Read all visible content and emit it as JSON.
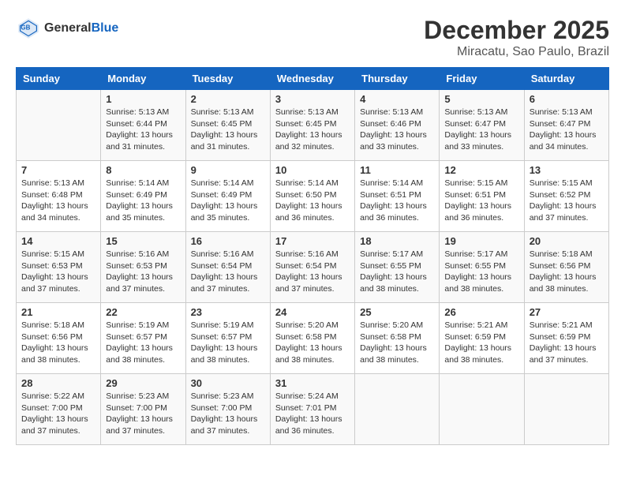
{
  "header": {
    "logo_line1": "General",
    "logo_line2": "Blue",
    "month_year": "December 2025",
    "location": "Miracatu, Sao Paulo, Brazil"
  },
  "days_of_week": [
    "Sunday",
    "Monday",
    "Tuesday",
    "Wednesday",
    "Thursday",
    "Friday",
    "Saturday"
  ],
  "weeks": [
    [
      {
        "day": "",
        "info": ""
      },
      {
        "day": "1",
        "info": "Sunrise: 5:13 AM\nSunset: 6:44 PM\nDaylight: 13 hours\nand 31 minutes."
      },
      {
        "day": "2",
        "info": "Sunrise: 5:13 AM\nSunset: 6:45 PM\nDaylight: 13 hours\nand 31 minutes."
      },
      {
        "day": "3",
        "info": "Sunrise: 5:13 AM\nSunset: 6:45 PM\nDaylight: 13 hours\nand 32 minutes."
      },
      {
        "day": "4",
        "info": "Sunrise: 5:13 AM\nSunset: 6:46 PM\nDaylight: 13 hours\nand 33 minutes."
      },
      {
        "day": "5",
        "info": "Sunrise: 5:13 AM\nSunset: 6:47 PM\nDaylight: 13 hours\nand 33 minutes."
      },
      {
        "day": "6",
        "info": "Sunrise: 5:13 AM\nSunset: 6:47 PM\nDaylight: 13 hours\nand 34 minutes."
      }
    ],
    [
      {
        "day": "7",
        "info": "Sunrise: 5:13 AM\nSunset: 6:48 PM\nDaylight: 13 hours\nand 34 minutes."
      },
      {
        "day": "8",
        "info": "Sunrise: 5:14 AM\nSunset: 6:49 PM\nDaylight: 13 hours\nand 35 minutes."
      },
      {
        "day": "9",
        "info": "Sunrise: 5:14 AM\nSunset: 6:49 PM\nDaylight: 13 hours\nand 35 minutes."
      },
      {
        "day": "10",
        "info": "Sunrise: 5:14 AM\nSunset: 6:50 PM\nDaylight: 13 hours\nand 36 minutes."
      },
      {
        "day": "11",
        "info": "Sunrise: 5:14 AM\nSunset: 6:51 PM\nDaylight: 13 hours\nand 36 minutes."
      },
      {
        "day": "12",
        "info": "Sunrise: 5:15 AM\nSunset: 6:51 PM\nDaylight: 13 hours\nand 36 minutes."
      },
      {
        "day": "13",
        "info": "Sunrise: 5:15 AM\nSunset: 6:52 PM\nDaylight: 13 hours\nand 37 minutes."
      }
    ],
    [
      {
        "day": "14",
        "info": "Sunrise: 5:15 AM\nSunset: 6:53 PM\nDaylight: 13 hours\nand 37 minutes."
      },
      {
        "day": "15",
        "info": "Sunrise: 5:16 AM\nSunset: 6:53 PM\nDaylight: 13 hours\nand 37 minutes."
      },
      {
        "day": "16",
        "info": "Sunrise: 5:16 AM\nSunset: 6:54 PM\nDaylight: 13 hours\nand 37 minutes."
      },
      {
        "day": "17",
        "info": "Sunrise: 5:16 AM\nSunset: 6:54 PM\nDaylight: 13 hours\nand 37 minutes."
      },
      {
        "day": "18",
        "info": "Sunrise: 5:17 AM\nSunset: 6:55 PM\nDaylight: 13 hours\nand 38 minutes."
      },
      {
        "day": "19",
        "info": "Sunrise: 5:17 AM\nSunset: 6:55 PM\nDaylight: 13 hours\nand 38 minutes."
      },
      {
        "day": "20",
        "info": "Sunrise: 5:18 AM\nSunset: 6:56 PM\nDaylight: 13 hours\nand 38 minutes."
      }
    ],
    [
      {
        "day": "21",
        "info": "Sunrise: 5:18 AM\nSunset: 6:56 PM\nDaylight: 13 hours\nand 38 minutes."
      },
      {
        "day": "22",
        "info": "Sunrise: 5:19 AM\nSunset: 6:57 PM\nDaylight: 13 hours\nand 38 minutes."
      },
      {
        "day": "23",
        "info": "Sunrise: 5:19 AM\nSunset: 6:57 PM\nDaylight: 13 hours\nand 38 minutes."
      },
      {
        "day": "24",
        "info": "Sunrise: 5:20 AM\nSunset: 6:58 PM\nDaylight: 13 hours\nand 38 minutes."
      },
      {
        "day": "25",
        "info": "Sunrise: 5:20 AM\nSunset: 6:58 PM\nDaylight: 13 hours\nand 38 minutes."
      },
      {
        "day": "26",
        "info": "Sunrise: 5:21 AM\nSunset: 6:59 PM\nDaylight: 13 hours\nand 38 minutes."
      },
      {
        "day": "27",
        "info": "Sunrise: 5:21 AM\nSunset: 6:59 PM\nDaylight: 13 hours\nand 37 minutes."
      }
    ],
    [
      {
        "day": "28",
        "info": "Sunrise: 5:22 AM\nSunset: 7:00 PM\nDaylight: 13 hours\nand 37 minutes."
      },
      {
        "day": "29",
        "info": "Sunrise: 5:23 AM\nSunset: 7:00 PM\nDaylight: 13 hours\nand 37 minutes."
      },
      {
        "day": "30",
        "info": "Sunrise: 5:23 AM\nSunset: 7:00 PM\nDaylight: 13 hours\nand 37 minutes."
      },
      {
        "day": "31",
        "info": "Sunrise: 5:24 AM\nSunset: 7:01 PM\nDaylight: 13 hours\nand 36 minutes."
      },
      {
        "day": "",
        "info": ""
      },
      {
        "day": "",
        "info": ""
      },
      {
        "day": "",
        "info": ""
      }
    ]
  ]
}
